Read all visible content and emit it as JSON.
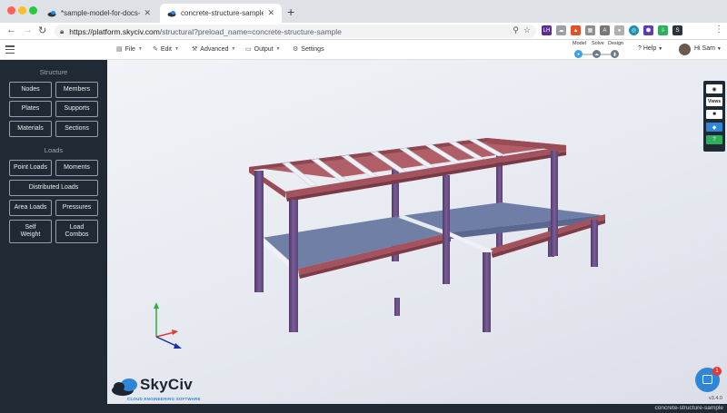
{
  "browser": {
    "tabs": [
      {
        "title": "*sample-model-for-docs-concrete",
        "active": false
      },
      {
        "title": "concrete-structure-sample | SkyCiv",
        "active": true
      }
    ],
    "url_host": "https://platform.skyciv.com",
    "url_path": "/structural?preload_name=concrete-structure-sample",
    "extensions": [
      "LH",
      "cloud",
      "flame",
      "calendar",
      "font",
      "circle",
      "target",
      "shield",
      "download",
      "skyciv"
    ]
  },
  "toolbar": {
    "file_label": "File",
    "edit_label": "Edit",
    "advanced_label": "Advanced",
    "output_label": "Output",
    "settings_label": "Settings",
    "mode_model": "Model",
    "mode_solve": "Solve",
    "mode_design": "Design",
    "help_label": "Help",
    "user_label": "Hi Sam"
  },
  "sidebar": {
    "structure_title": "Structure",
    "structure_buttons": [
      "Nodes",
      "Members",
      "Plates",
      "Supports",
      "Materials",
      "Sections"
    ],
    "loads_title": "Loads",
    "loads_buttons": [
      "Point Loads",
      "Moments",
      "Distributed Loads",
      "Area Loads",
      "Pressures",
      "Self Weight",
      "Load Combos"
    ]
  },
  "viewport": {
    "right_tools": [
      "eye-icon",
      "Views",
      "camera-icon",
      "cube-icon",
      "help-icon"
    ],
    "logo_text": "SkyCiv",
    "logo_subtitle": "CLOUD ENGINEERING SOFTWARE",
    "chat_badge": "1",
    "version": "v3.4.0"
  },
  "status": {
    "model_name": "concrete-structure-sample"
  },
  "colors": {
    "sidebar_bg": "#1f2a35",
    "accent_blue": "#2f86d8",
    "column_purple": "#6a4f86",
    "beam_maroon": "#a4535e",
    "slab_blue": "#6e7ea6",
    "secondary_beam": "#e6eaf1"
  }
}
